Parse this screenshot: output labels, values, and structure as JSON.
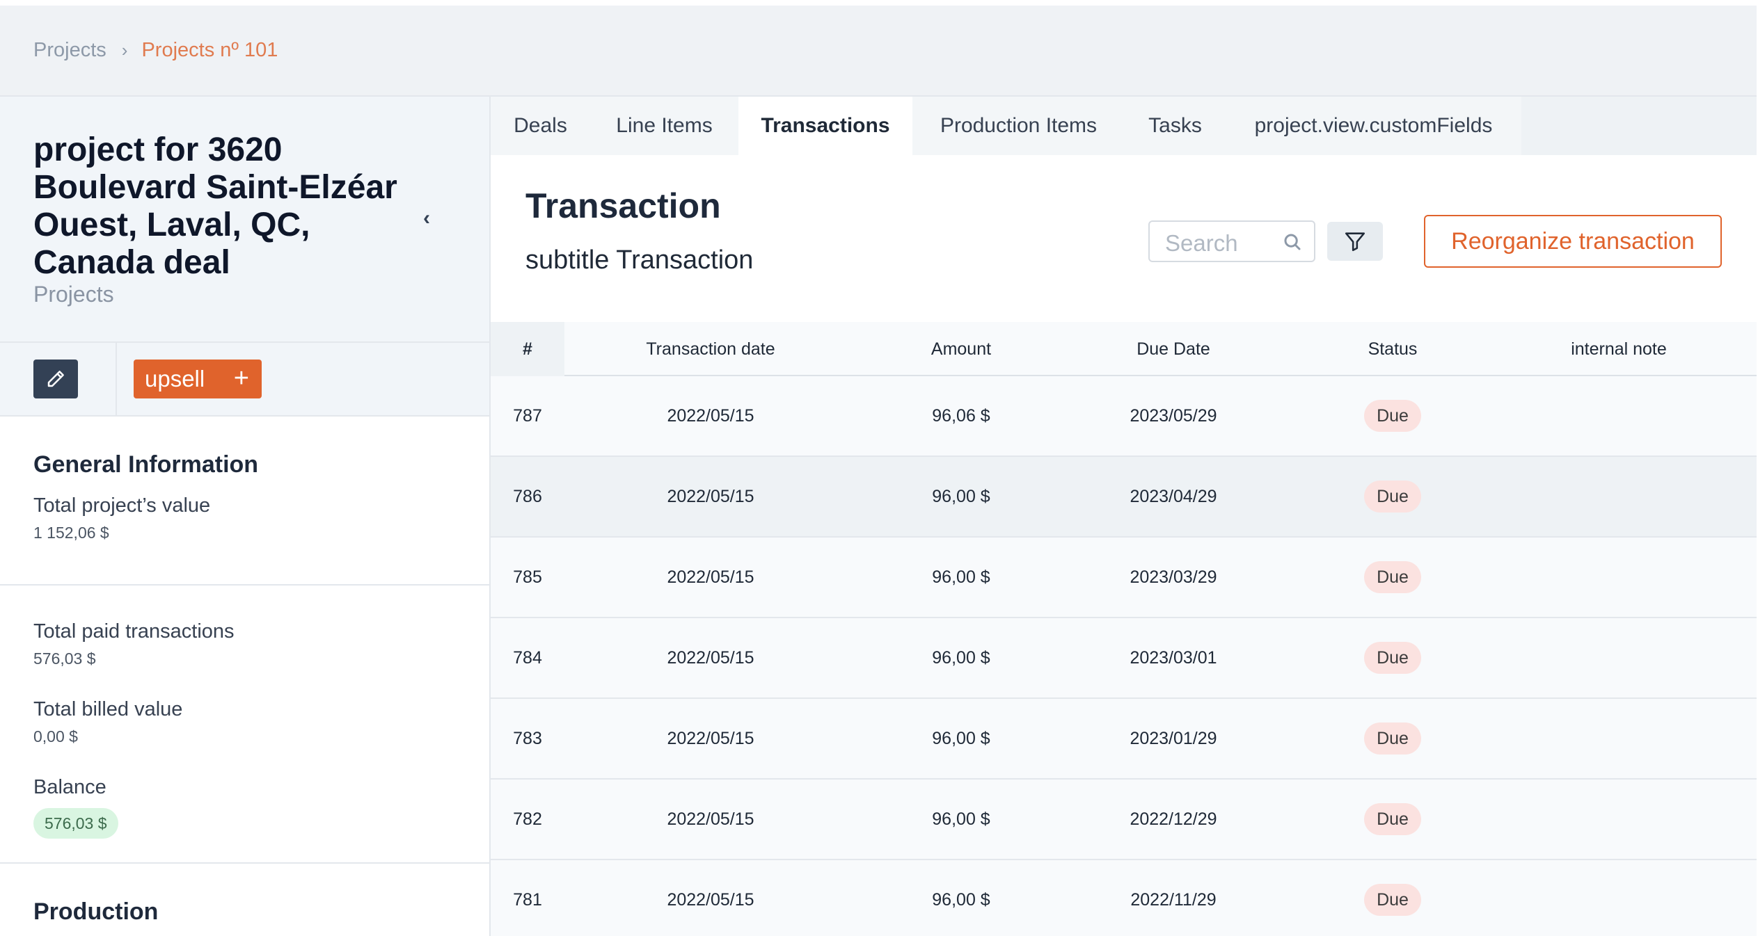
{
  "breadcrumb": {
    "root": "Projects",
    "separator": "›",
    "current": "Projects nº 101"
  },
  "project": {
    "title": "project for 3620 Boulevard Saint-Elzéar Ouest, Laval, QC, Canada deal",
    "subtitle": "Projects",
    "collapse_icon": "‹",
    "upsell_label": "upsell",
    "upsell_plus": "+"
  },
  "general": {
    "title": "General Information",
    "total_value_label": "Total project’s value",
    "total_value": "1 152,06 $",
    "paid_label": "Total paid transactions",
    "paid_value": "576,03 $",
    "billed_label": "Total billed value",
    "billed_value": "0,00 $",
    "balance_label": "Balance",
    "balance_value": "576,03 $"
  },
  "production": {
    "title": "Production"
  },
  "tabs": [
    {
      "label": "Deals"
    },
    {
      "label": "Line Items"
    },
    {
      "label": "Transactions"
    },
    {
      "label": "Production Items"
    },
    {
      "label": "Tasks"
    },
    {
      "label": "project.view.customFields"
    }
  ],
  "content": {
    "title": "Transaction",
    "subtitle": "subtitle Transaction",
    "search_placeholder": "Search",
    "reorganize_label": "Reorganize transaction"
  },
  "table": {
    "headers": {
      "id": "#",
      "date": "Transaction date",
      "amount": "Amount",
      "due": "Due Date",
      "status": "Status",
      "note": "internal note"
    },
    "rows": [
      {
        "id": "787",
        "date": "2022/05/15",
        "amount": "96,06 $",
        "due": "2023/05/29",
        "status": "Due",
        "note": ""
      },
      {
        "id": "786",
        "date": "2022/05/15",
        "amount": "96,00 $",
        "due": "2023/04/29",
        "status": "Due",
        "note": ""
      },
      {
        "id": "785",
        "date": "2022/05/15",
        "amount": "96,00 $",
        "due": "2023/03/29",
        "status": "Due",
        "note": ""
      },
      {
        "id": "784",
        "date": "2022/05/15",
        "amount": "96,00 $",
        "due": "2023/03/01",
        "status": "Due",
        "note": ""
      },
      {
        "id": "783",
        "date": "2022/05/15",
        "amount": "96,00 $",
        "due": "2023/01/29",
        "status": "Due",
        "note": ""
      },
      {
        "id": "782",
        "date": "2022/05/15",
        "amount": "96,00 $",
        "due": "2022/12/29",
        "status": "Due",
        "note": ""
      },
      {
        "id": "781",
        "date": "2022/05/15",
        "amount": "96,00 $",
        "due": "2022/11/29",
        "status": "Due",
        "note": ""
      }
    ]
  },
  "colors": {
    "accent": "#e0632c",
    "breadcrumb_current": "#e07b4f",
    "status_due_bg": "#fbe2e0",
    "balance_bg": "#d9f5e1",
    "edit_button_bg": "#334155"
  },
  "icons": {
    "edit": "pencil-icon",
    "search": "search-icon",
    "filter": "filter-icon",
    "collapse": "chevron-left-icon",
    "breadcrumb_separator": "chevron-right-icon"
  }
}
